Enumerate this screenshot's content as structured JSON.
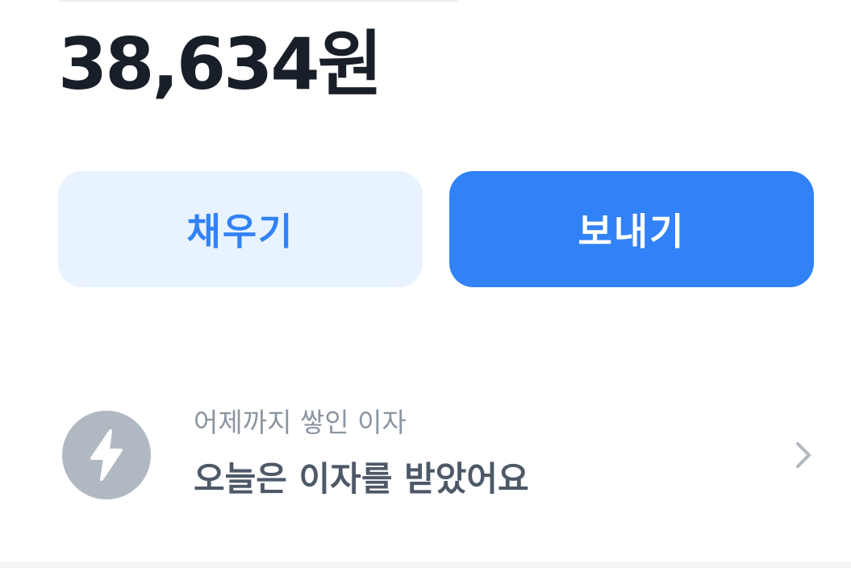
{
  "account": {
    "balance": "38,634원"
  },
  "actions": {
    "fill_label": "채우기",
    "send_label": "보내기"
  },
  "interest": {
    "caption": "어제까지 쌓인 이자",
    "title": "오늘은 이자를 받았어요",
    "icon": "lightning-bolt-icon",
    "chevron_icon": "chevron-right-icon"
  },
  "colors": {
    "primary": "#3182f6",
    "primary_light": "#e8f3ff",
    "text_primary": "#191f28",
    "text_secondary": "#4e5968",
    "text_tertiary": "#8b95a1",
    "icon_bg": "#b0b8c1"
  }
}
